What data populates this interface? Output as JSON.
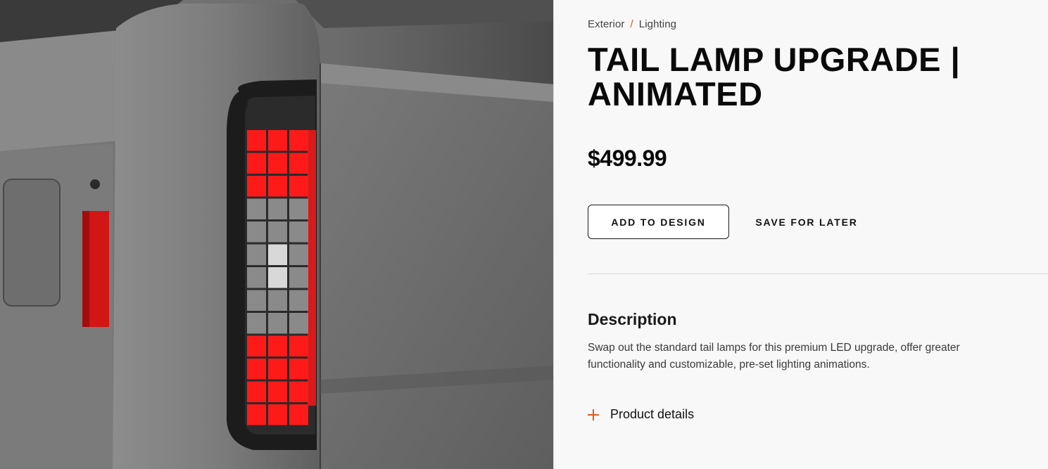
{
  "breadcrumb": {
    "items": [
      "Exterior",
      "Lighting"
    ],
    "separator": "/"
  },
  "product": {
    "title": "TAIL LAMP UPGRADE | ANIMATED",
    "price": "$499.99",
    "image_alt": "Animated LED tail lamp mounted on gray truck bed"
  },
  "actions": {
    "add_label": "ADD TO DESIGN",
    "save_label": "SAVE FOR LATER"
  },
  "description": {
    "heading": "Description",
    "text": "Swap out the standard tail lamps for this premium LED upgrade, offer greater functionality and customizable, pre-set lighting animations."
  },
  "details": {
    "label": "Product details",
    "icon": "plus-icon"
  },
  "colors": {
    "accent": "#e05a1f",
    "lamp_red": "#ff1a1a",
    "background": "#f8f8f8"
  }
}
